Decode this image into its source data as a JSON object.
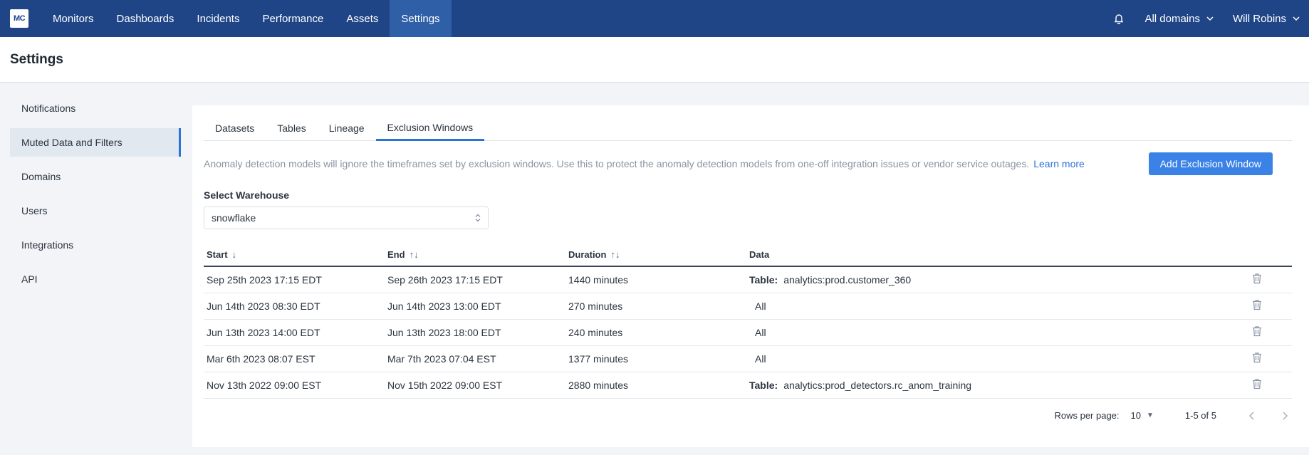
{
  "topnav": {
    "logo": "MC",
    "items": [
      {
        "label": "Monitors"
      },
      {
        "label": "Dashboards"
      },
      {
        "label": "Incidents"
      },
      {
        "label": "Performance"
      },
      {
        "label": "Assets"
      },
      {
        "label": "Settings",
        "active": true
      }
    ],
    "domains_label": "All domains",
    "user_label": "Will Robins",
    "icons": {
      "notifications": "bell-icon",
      "dropdown": "chevron-down-icon"
    }
  },
  "page": {
    "title": "Settings"
  },
  "sidebar": {
    "items": [
      {
        "label": "Notifications"
      },
      {
        "label": "Muted Data and Filters",
        "active": true
      },
      {
        "label": "Domains"
      },
      {
        "label": "Users"
      },
      {
        "label": "Integrations"
      },
      {
        "label": "API"
      }
    ]
  },
  "tabs": [
    {
      "label": "Datasets"
    },
    {
      "label": "Tables"
    },
    {
      "label": "Lineage"
    },
    {
      "label": "Exclusion Windows",
      "active": true
    }
  ],
  "description": {
    "text": "Anomaly detection models will ignore the timeframes set by exclusion windows. Use this to protect the anomaly detection models from one-off integration issues or vendor service outages.",
    "learn_more": "Learn more"
  },
  "add_button_label": "Add Exclusion Window",
  "warehouse": {
    "label": "Select Warehouse",
    "value": "snowflake"
  },
  "table": {
    "headers": {
      "start": "Start",
      "end": "End",
      "duration": "Duration",
      "data": "Data"
    },
    "sort_icons": {
      "start": "↓",
      "end": "↑↓",
      "duration": "↑↓"
    },
    "rows": [
      {
        "start": "Sep 25th 2023 17:15 EDT",
        "end": "Sep 26th 2023 17:15 EDT",
        "duration": "1440 minutes",
        "data_label": "Table:",
        "data_value": "analytics:prod.customer_360"
      },
      {
        "start": "Jun 14th 2023 08:30 EDT",
        "end": "Jun 14th 2023 13:00 EDT",
        "duration": "270 minutes",
        "data_label": "",
        "data_value": "All"
      },
      {
        "start": "Jun 13th 2023 14:00 EDT",
        "end": "Jun 13th 2023 18:00 EDT",
        "duration": "240 minutes",
        "data_label": "",
        "data_value": "All"
      },
      {
        "start": "Mar 6th 2023 08:07 EST",
        "end": "Mar 7th 2023 07:04 EST",
        "duration": "1377 minutes",
        "data_label": "",
        "data_value": "All"
      },
      {
        "start": "Nov 13th 2022 09:00 EST",
        "end": "Nov 15th 2022 09:00 EST",
        "duration": "2880 minutes",
        "data_label": "Table:",
        "data_value": "analytics:prod_detectors.rc_anom_training"
      }
    ]
  },
  "pagination": {
    "rows_per_page_label": "Rows per page:",
    "rows_per_page_value": "10",
    "range": "1-5 of 5"
  },
  "colors": {
    "nav_bg": "#1f4587",
    "nav_active": "#2f5fa7",
    "accent": "#2c73d8",
    "button": "#3b82e6"
  }
}
